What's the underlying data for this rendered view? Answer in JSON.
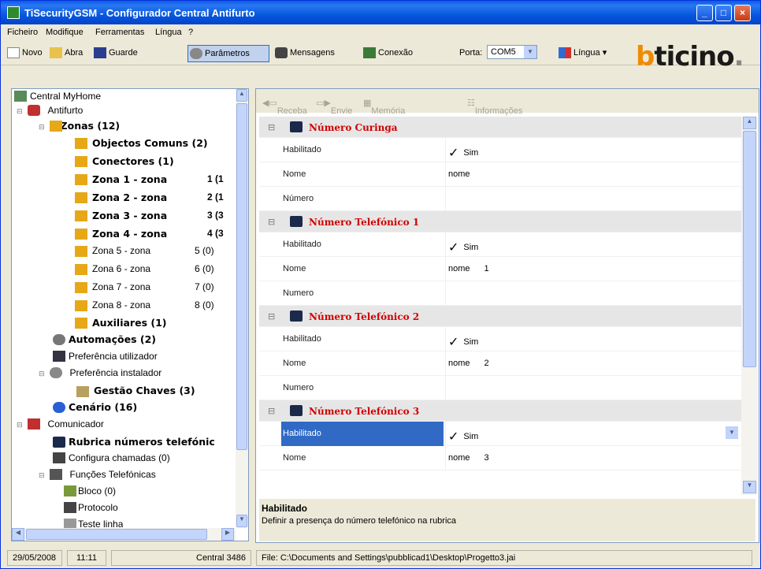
{
  "window": {
    "title": "TiSecurityGSM - Configurador Central Antifurto",
    "min": "_",
    "max": "□",
    "close": "×"
  },
  "menu": [
    "Ficheiro",
    "Modifique",
    "Ferramentas",
    "Língua",
    "?"
  ],
  "toolbar": {
    "novo": "Novo",
    "abra": "Abra",
    "guarde": "Guarde",
    "parametros": "Parâmetros",
    "mensagens": "Mensagens",
    "conexao": "Conexão",
    "porta_label": "Porta:",
    "porta_value": "COM5",
    "lingua": "Língua",
    "logo": "bticino."
  },
  "tree": {
    "root": "Central MyHome",
    "antifurto": "Antifurto",
    "zonas": "Zonas (12)",
    "objectos": "Objectos Comuns (2)",
    "conectores": "Conectores (1)",
    "zone_rows": [
      {
        "label": "Zona 1 - zona",
        "count": "1 (1"
      },
      {
        "label": "Zona 2 - zona",
        "count": "2 (1"
      },
      {
        "label": "Zona 3 - zona",
        "count": "3 (3"
      },
      {
        "label": "Zona 4 - zona",
        "count": "4 (3"
      },
      {
        "label": "Zona 5 - zona",
        "count": "5 (0)"
      },
      {
        "label": "Zona 6 - zona",
        "count": "6 (0)"
      },
      {
        "label": "Zona 7 - zona",
        "count": "7 (0)"
      },
      {
        "label": "Zona 8 - zona",
        "count": "8 (0)"
      }
    ],
    "auxiliares": "Auxiliares (1)",
    "automacoes": "Automações (2)",
    "pref_utilizador": "Preferência utilizador",
    "pref_instalador": "Preferência instalador",
    "gestao_chaves": "Gestão Chaves (3)",
    "cenario": "Cenário (16)",
    "comunicador": "Comunicador",
    "rubrica": "Rubrica números telefónic",
    "configura": "Configura chamadas (0)",
    "funcoes": "Funções Telefónicas",
    "bloco": "Bloco (0)",
    "protocolo": "Protocolo",
    "teste": "Teste linha"
  },
  "right_toolbar": {
    "receba": "Receba",
    "envie": "Envie",
    "memoria": "Memória eventos",
    "informacoes": "Informações"
  },
  "grid": {
    "sections": [
      {
        "title": "Número Curinga",
        "rows": [
          {
            "label": "Habilitado",
            "value": "Sim",
            "check": "✓"
          },
          {
            "label": "Nome",
            "value": "nome",
            "extra": ""
          },
          {
            "label": "Número",
            "value": ""
          }
        ]
      },
      {
        "title": "Número Telefónico 1",
        "rows": [
          {
            "label": "Habilitado",
            "value": "Sim",
            "check": "✓"
          },
          {
            "label": "Nome",
            "value": "nome",
            "extra": "1"
          },
          {
            "label": "Numero",
            "value": ""
          }
        ]
      },
      {
        "title": "Número Telefónico 2",
        "rows": [
          {
            "label": "Habilitado",
            "value": "Sim",
            "check": "✓"
          },
          {
            "label": "Nome",
            "value": "nome",
            "extra": "2"
          },
          {
            "label": "Numero",
            "value": ""
          }
        ]
      },
      {
        "title": "Número Telefónico 3",
        "rows": [
          {
            "label": "Habilitado",
            "value": "Sim",
            "check": "✓"
          },
          {
            "label": "Nome",
            "value": "nome",
            "extra": "3"
          }
        ]
      }
    ]
  },
  "description": {
    "title": "Habilitado",
    "text": "Definir a presença do número telefónico na rubrica"
  },
  "status": {
    "date": "29/05/2008",
    "time": "11:11",
    "central": "Central 3486",
    "file": "File: C:\\Documents and Settings\\pubblicad1\\Desktop\\Progetto3.jai"
  },
  "colors": {
    "accent": "#316ac5",
    "section_title": "#d00000",
    "logo_orange": "#f08a00"
  }
}
